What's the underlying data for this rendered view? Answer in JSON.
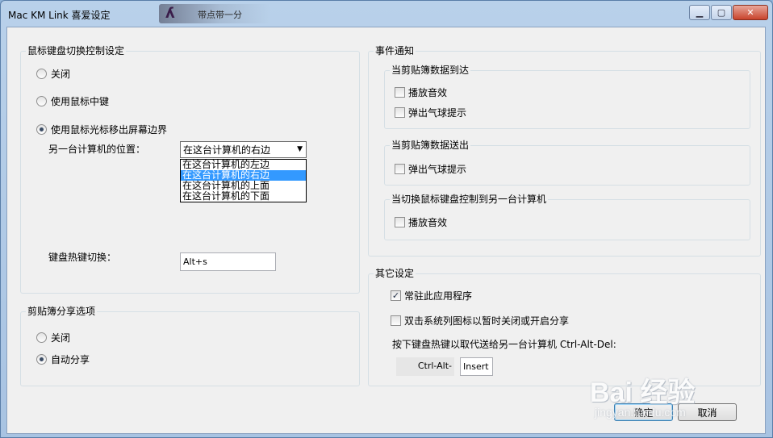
{
  "window": {
    "title": "Mac KM Link 喜爱设定",
    "title_decoration_text": "带点带一分"
  },
  "kvm_group": {
    "title": "鼠标键盘切换控制设定",
    "options": [
      "关闭",
      "使用鼠标中键",
      "使用鼠标光标移出屏幕边界"
    ],
    "selected_option": 2,
    "position_label": "另一台计算机的位置：",
    "position_selected": "在这台计算机的右边",
    "position_options": [
      "在这台计算机的左边",
      "在这台计算机的右边",
      "在这台计算机的上面",
      "在这台计算机的下面"
    ],
    "position_highlighted": 1,
    "hotkey_label": "键盘热键切换：",
    "hotkey_value": "Alt+s"
  },
  "clipboard_group": {
    "title": "剪贴簿分享选项",
    "options": [
      "关闭",
      "自动分享"
    ],
    "selected_option": 1
  },
  "event_group": {
    "title": "事件通知",
    "arrive": {
      "title": "当剪贴簿数据到达",
      "play_sound": "播放音效",
      "balloon": "弹出气球提示"
    },
    "send": {
      "title": "当剪贴簿数据送出",
      "balloon": "弹出气球提示"
    },
    "switch": {
      "title": "当切换鼠标键盘控制到另一台计算机",
      "play_sound": "播放音效"
    }
  },
  "other_group": {
    "title": "其它设定",
    "resident": {
      "label": "常驻此应用程序",
      "checked": true
    },
    "double_click": {
      "label": "双击系统列图标以暂时关闭或开启分享",
      "checked": false
    },
    "cad_label": "按下键盘热键以取代送给另一台计算机 Ctrl-Alt-Del:",
    "cad_prefix": "Ctrl-Alt-",
    "cad_key": "Insert"
  },
  "buttons": {
    "ok": "确定",
    "cancel": "取消"
  },
  "watermark": {
    "main": "Bai 经验",
    "sub": "jingyan.baidu.com"
  }
}
